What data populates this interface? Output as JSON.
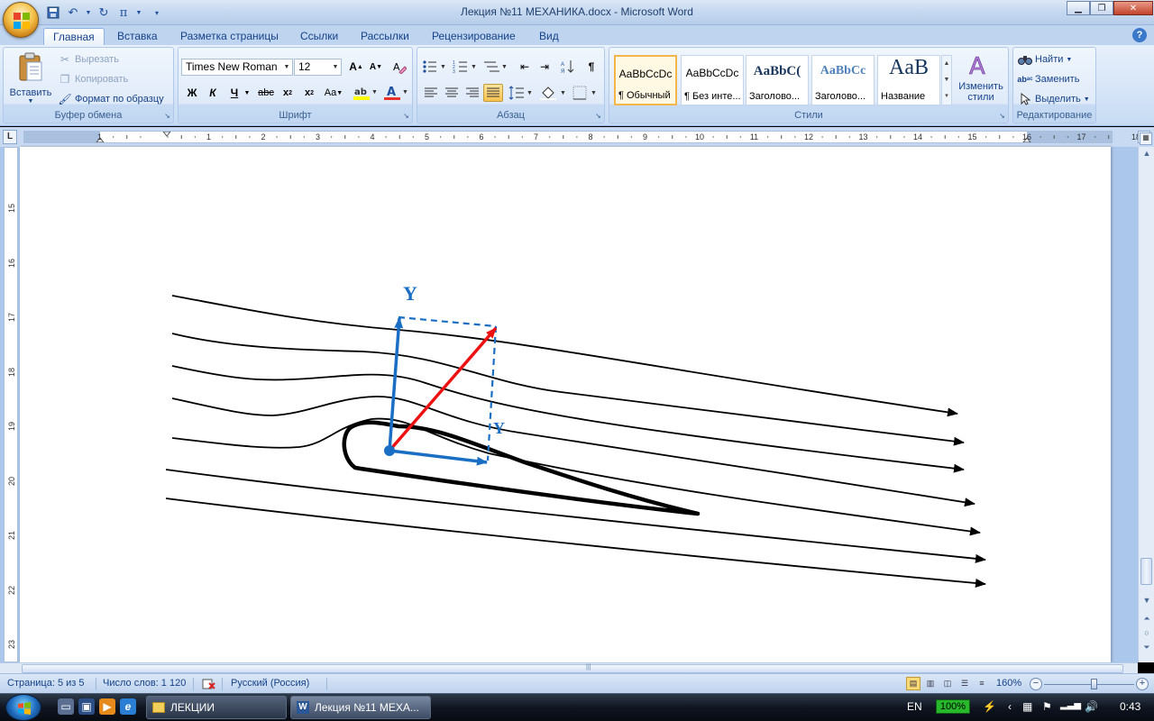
{
  "window": {
    "title": "Лекция №11 МЕХАНИКА.docx - Microsoft Word"
  },
  "ribbon": {
    "tabs": [
      "Главная",
      "Вставка",
      "Разметка страницы",
      "Ссылки",
      "Рассылки",
      "Рецензирование",
      "Вид"
    ],
    "active_tab": "Главная",
    "clipboard": {
      "label": "Буфер обмена",
      "paste": "Вставить",
      "cut": "Вырезать",
      "copy": "Копировать",
      "format_painter": "Формат по образцу"
    },
    "font": {
      "label": "Шрифт",
      "font_name": "Times New Roman",
      "font_size": "12"
    },
    "paragraph": {
      "label": "Абзац"
    },
    "styles": {
      "label": "Стили",
      "items": [
        {
          "sample": "AaBbCcDc",
          "name": "¶ Обычный"
        },
        {
          "sample": "AaBbCcDc",
          "name": "¶ Без инте..."
        },
        {
          "sample": "AaBbC(",
          "name": "Заголово..."
        },
        {
          "sample": "AaBbCc",
          "name": "Заголово..."
        },
        {
          "sample": "AaB",
          "name": "Название"
        }
      ],
      "change_styles": "Изменить стили"
    },
    "editing": {
      "label": "Редактирование",
      "find": "Найти",
      "replace": "Заменить",
      "select": "Выделить"
    }
  },
  "ruler": {
    "h_numbers": [
      "1",
      "1",
      "2",
      "3",
      "4",
      "5",
      "6",
      "7",
      "8",
      "9",
      "10",
      "11",
      "12",
      "13",
      "14",
      "15",
      "16",
      "17",
      "18"
    ],
    "v_numbers": [
      "15",
      "16",
      "17",
      "18",
      "19",
      "20",
      "21",
      "22",
      "23"
    ]
  },
  "figure": {
    "label_y_top": "Y",
    "label_y_mid": "Y",
    "colors": {
      "lift": "#1a6fc4",
      "resultant": "#ee1111",
      "lines": "#000000"
    }
  },
  "statusbar": {
    "page": "Страница: 5 из 5",
    "words": "Число слов: 1 120",
    "language": "Русский (Россия)",
    "zoom": "160%"
  },
  "taskbar": {
    "tasks": [
      "ЛЕКЦИИ",
      "Лекция №11 МЕХА..."
    ],
    "lang": "EN",
    "battery": "100%",
    "clock": "0:43"
  }
}
